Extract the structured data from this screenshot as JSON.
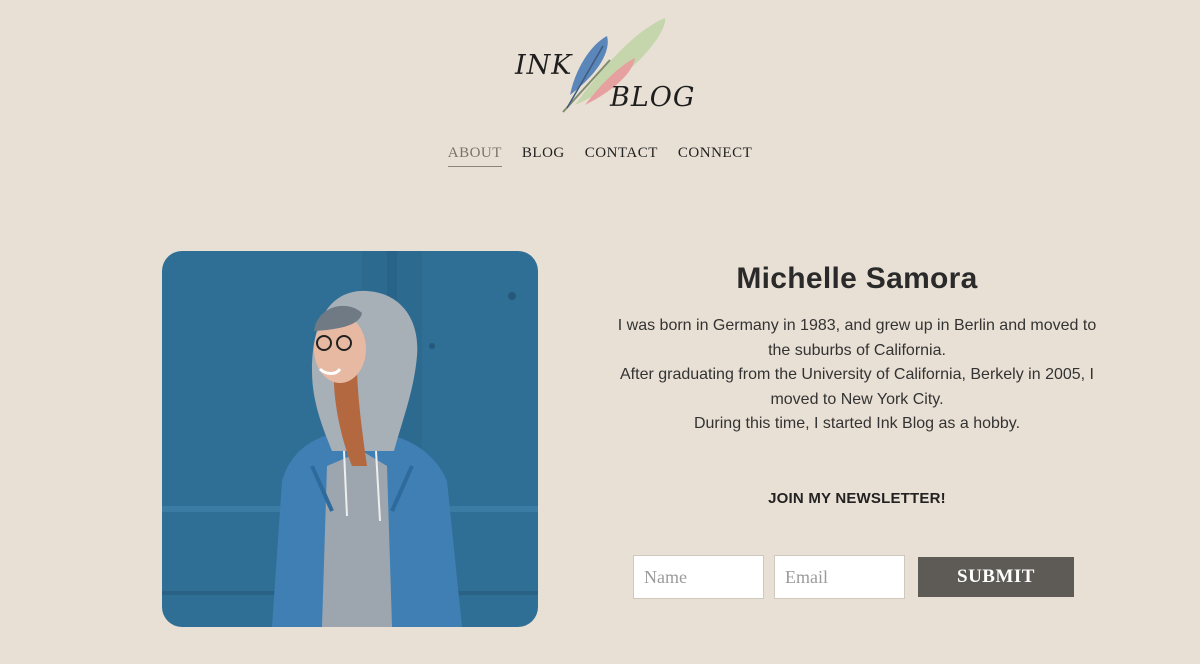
{
  "brand": {
    "logo_word1": "INK",
    "logo_word2": "BLOG",
    "feather_colors": [
      "#5a86b9",
      "#c5d6ad",
      "#e7a0a0"
    ]
  },
  "nav": {
    "items": [
      {
        "label": "ABOUT",
        "active": true
      },
      {
        "label": "BLOG",
        "active": false
      },
      {
        "label": "CONTACT",
        "active": false
      },
      {
        "label": "CONNECT",
        "active": false
      }
    ]
  },
  "profile": {
    "name": "Michelle Samora",
    "bio_lines": [
      "I was born in Germany in 1983, and grew up in Berlin and moved to the suburbs of California.",
      "After graduating from the University of California, Berkely in 2005, I moved to New York City.",
      "During this time, I started Ink Blog as a hobby."
    ]
  },
  "newsletter": {
    "title": "JOIN MY NEWSLETTER!",
    "name_placeholder": "Name",
    "email_placeholder": "Email",
    "submit_label": "SUBMIT"
  },
  "colors": {
    "background": "#e9e0d5",
    "button": "#5e5a56",
    "nav_active": "#7a716a"
  }
}
